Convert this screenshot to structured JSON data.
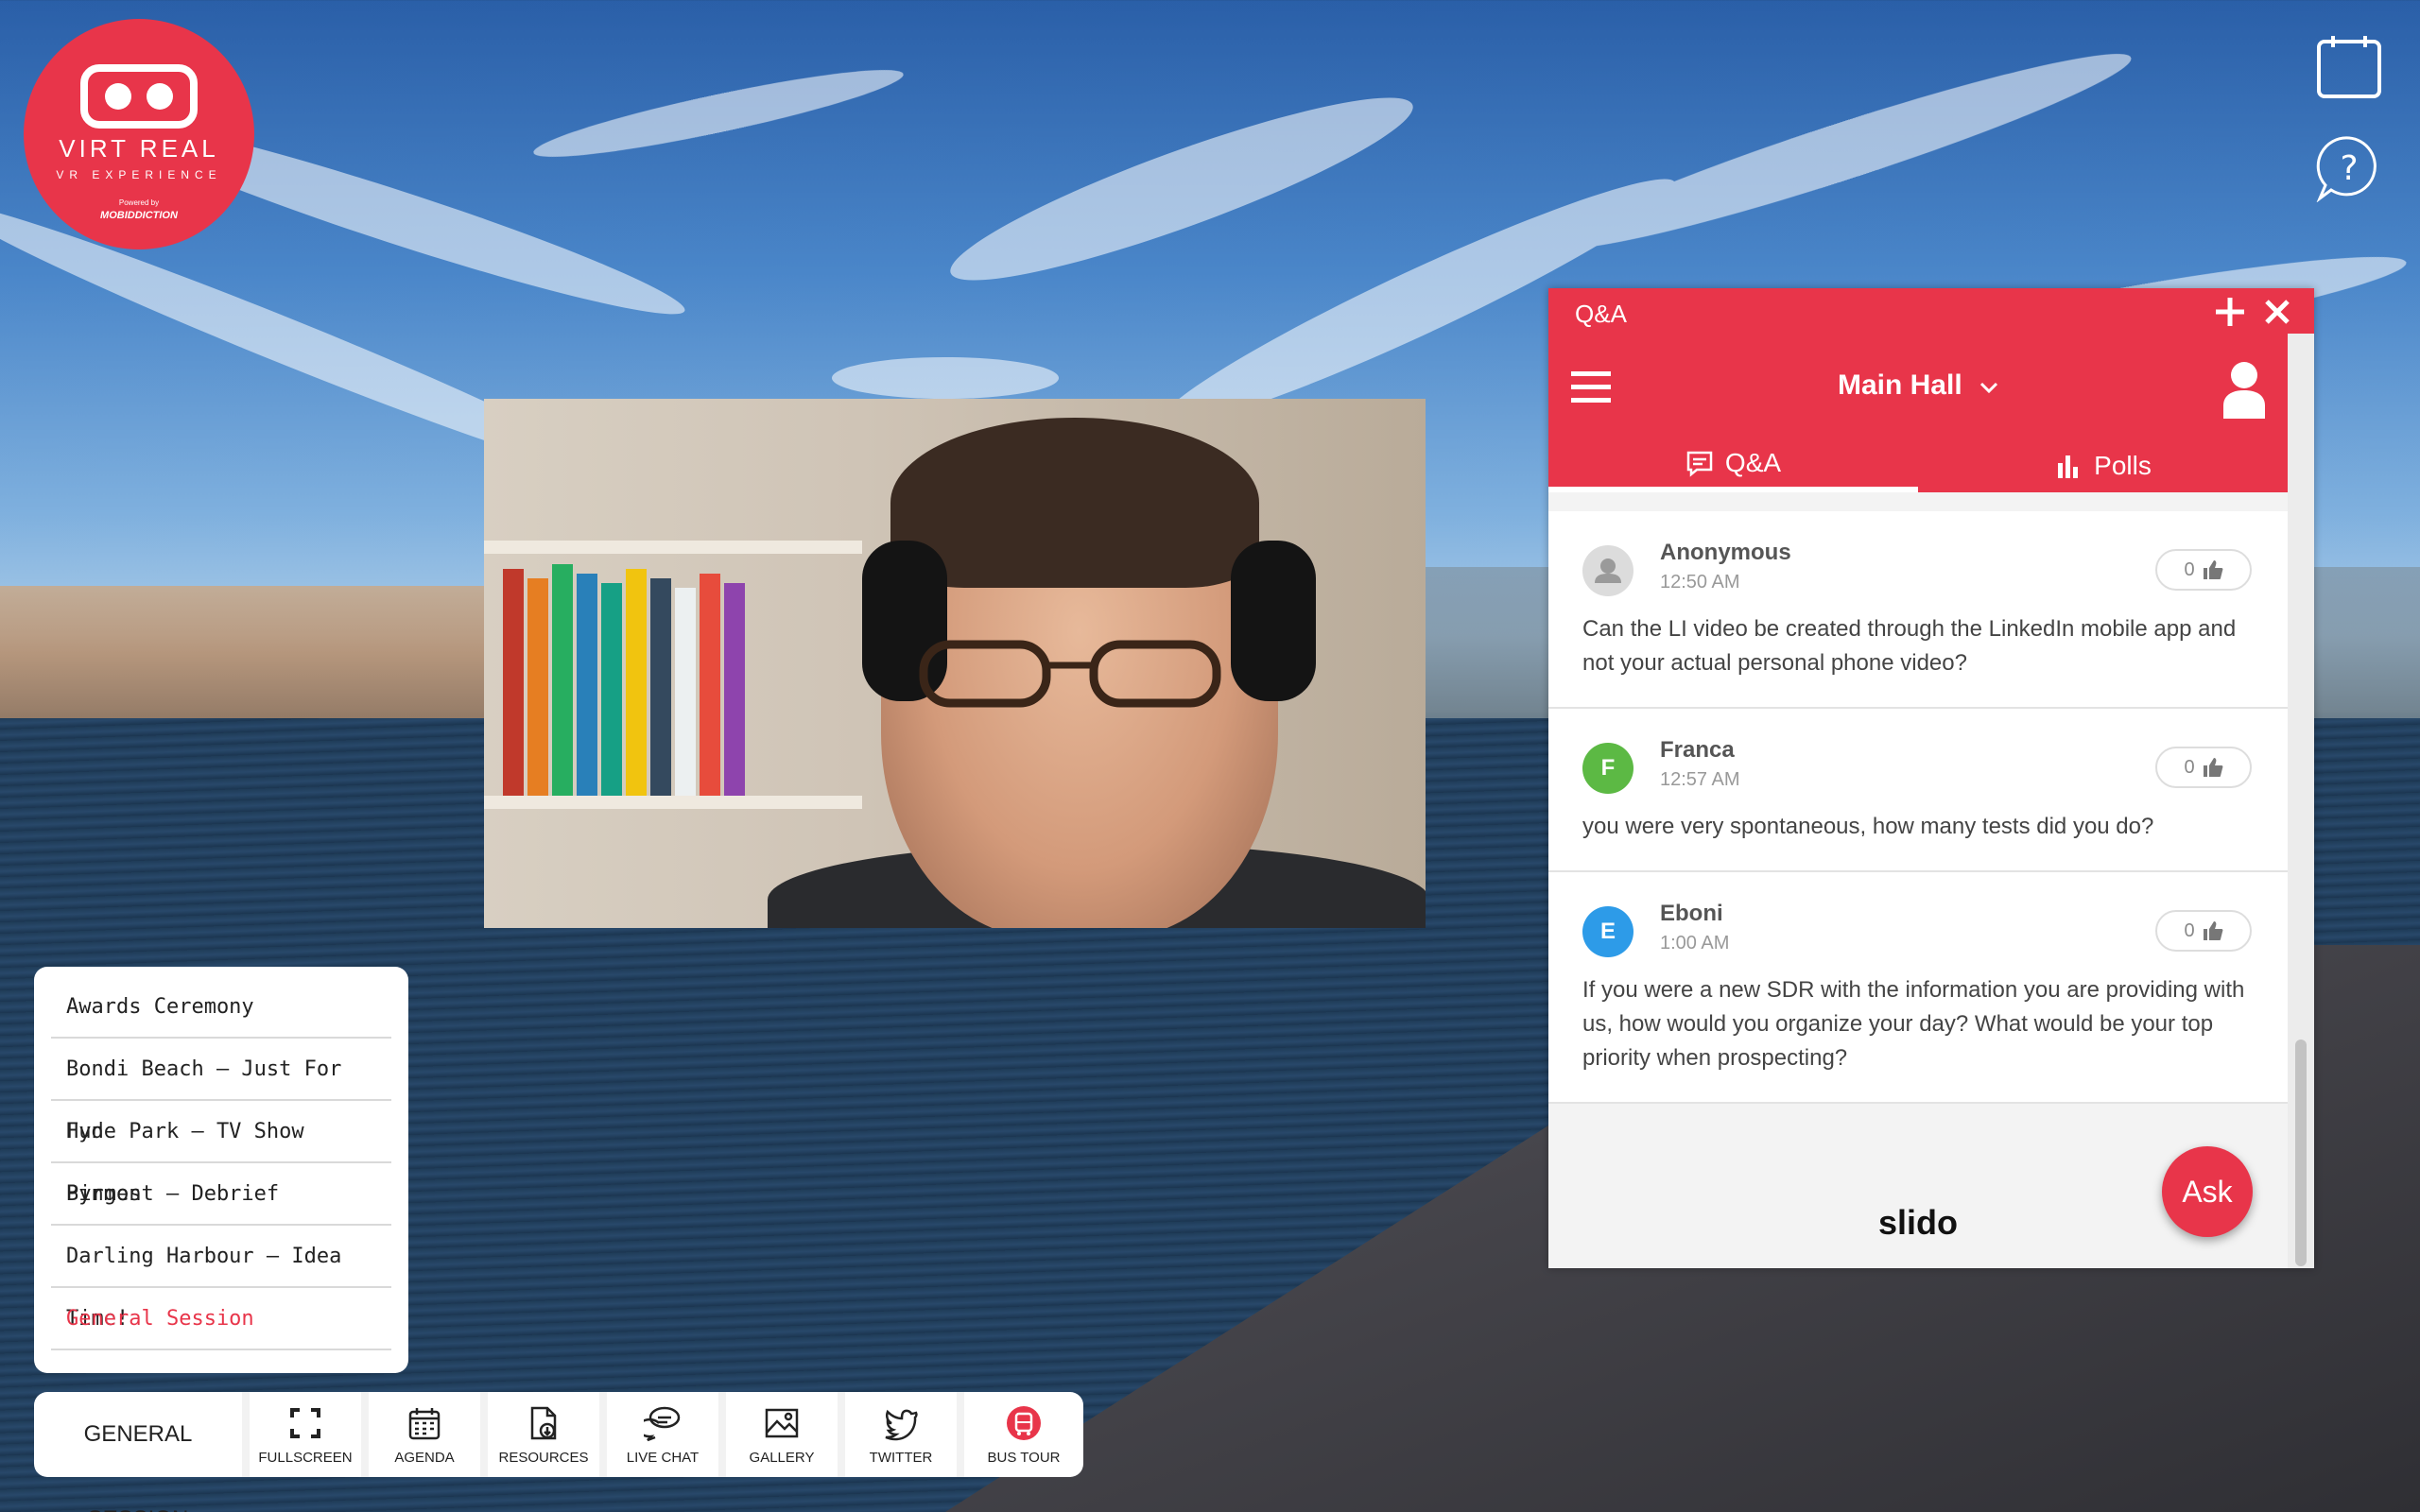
{
  "logo": {
    "brand": "VIRT REAL",
    "tagline": "VR EXPERIENCE",
    "powered_by": "Powered by",
    "company": "MOBIDDICTION"
  },
  "sessions": [
    {
      "label": "Awards Ceremony"
    },
    {
      "label": "Bondi Beach – Just For Fun"
    },
    {
      "label": "Hyde Park – TV Show Binges"
    },
    {
      "label": "Pyrmont – Debrief"
    },
    {
      "label": "Darling Harbour – Idea Time!"
    },
    {
      "label": "General Session"
    }
  ],
  "bottombar": {
    "current_session": "GENERAL SESSION",
    "tools": [
      {
        "label": "FULLSCREEN",
        "icon": "fullscreen-icon"
      },
      {
        "label": "AGENDA",
        "icon": "calendar-icon"
      },
      {
        "label": "RESOURCES",
        "icon": "document-download-icon"
      },
      {
        "label": "LIVE CHAT",
        "icon": "chat-bubbles-icon"
      },
      {
        "label": "GALLERY",
        "icon": "image-icon"
      },
      {
        "label": "TWITTER",
        "icon": "twitter-icon"
      },
      {
        "label": "BUS TOUR",
        "icon": "bus-icon"
      }
    ]
  },
  "qa_panel": {
    "title": "Q&A",
    "room": "Main Hall",
    "tabs": [
      {
        "label": "Q&A"
      },
      {
        "label": "Polls"
      }
    ],
    "questions": [
      {
        "author": "Anonymous",
        "initial": "",
        "avatar_color": "#dcdcdc",
        "time": "12:50 AM",
        "likes": "0",
        "text": "Can the LI video be created through the LinkedIn mobile app and not your actual personal phone video?"
      },
      {
        "author": "Franca",
        "initial": "F",
        "avatar_color": "#5cb944",
        "time": "12:57 AM",
        "likes": "0",
        "text": "you were very spontaneous, how many tests did you do?"
      },
      {
        "author": "Eboni",
        "initial": "E",
        "avatar_color": "#2d9be8",
        "time": "1:00 AM",
        "likes": "0",
        "text": "If you were a new SDR with the information you are providing with us, how would you organize your day? What would be your top priority when prospecting?"
      }
    ],
    "branding": "slido",
    "ask_label": "Ask"
  },
  "colors": {
    "accent": "#e8354a",
    "active_session": "#e8354a"
  }
}
